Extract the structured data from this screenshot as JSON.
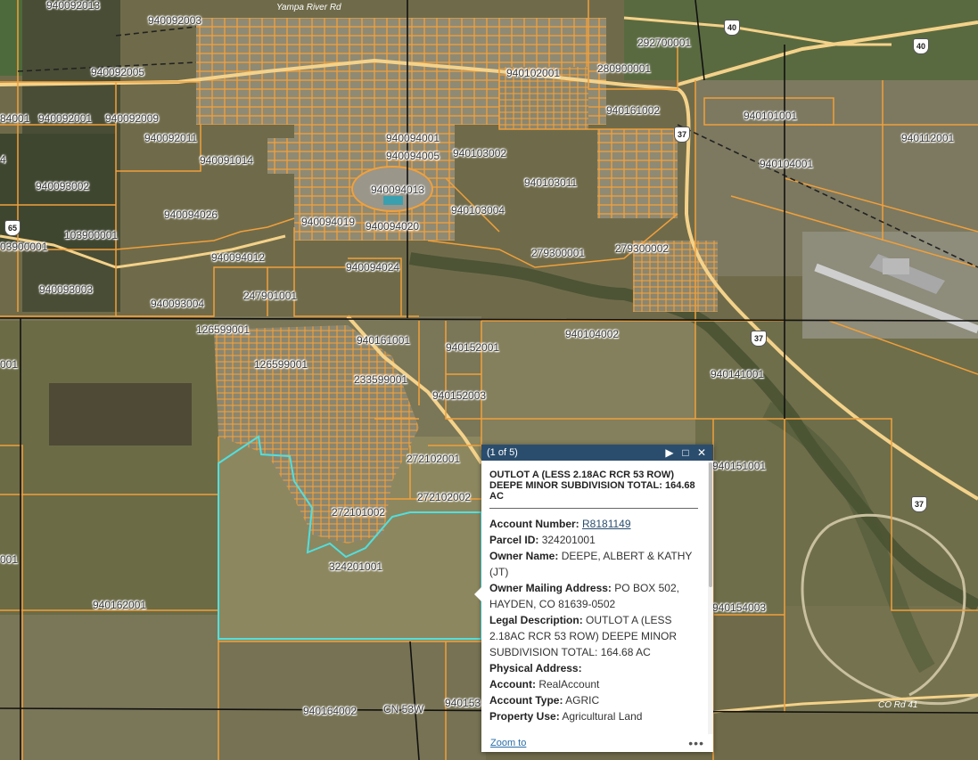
{
  "map": {
    "parcel_labels": [
      "940092013",
      "940092003",
      "940092005",
      "940092001",
      "940092009",
      "940092011",
      "940091014",
      "940093002",
      "940094026",
      "103900001",
      "940094012",
      "940093003",
      "940093004",
      "247901001",
      "940094019",
      "940094020",
      "940094024",
      "940094013",
      "940094001",
      "940094005",
      "940103002",
      "940103011",
      "940103004",
      "279300001",
      "279300002",
      "940102001",
      "292700001",
      "280900001",
      "940161002",
      "940101001",
      "940112001",
      "940104001",
      "126599001",
      "126599001",
      "940161001",
      "940152001",
      "233599001",
      "940152003",
      "940104002",
      "940141001",
      "272102001",
      "272102002",
      "272101002",
      "324201001",
      "940151001",
      "940162001",
      "940164002",
      "940153",
      "940154003",
      "84001",
      "4",
      "03900001",
      "001",
      "001"
    ],
    "highways": [
      "40",
      "40",
      "37",
      "37",
      "37",
      "65"
    ],
    "road_names": [
      "Yampa River Rd",
      "CN 53W",
      "CO Rd 41"
    ],
    "colors": {
      "parcel": "#f2a03a",
      "selected": "#4fe0e0",
      "grid": "#111111",
      "road": "#f4d28a",
      "header": "#2a4d6e"
    }
  },
  "popup": {
    "count": "(1 of 5)",
    "title": "OUTLOT A (LESS 2.18AC RCR 53 ROW) DEEPE MINOR SUBDIVISION TOTAL: 164.68 AC",
    "fields": [
      {
        "label": "Account Number:",
        "value": "R8181149",
        "link": true
      },
      {
        "label": "Parcel ID:",
        "value": "324201001"
      },
      {
        "label": "Owner Name:",
        "value": "DEEPE, ALBERT & KATHY (JT)"
      },
      {
        "label": "Owner Mailing Address:",
        "value": "PO BOX 502, HAYDEN, CO 81639-0502"
      },
      {
        "label": "Legal Description:",
        "value": "OUTLOT A (LESS 2.18AC RCR 53 ROW) DEEPE MINOR SUBDIVISION TOTAL: 164.68 AC"
      },
      {
        "label": "Physical Address:",
        "value": ""
      },
      {
        "label": "Account:",
        "value": "RealAccount"
      },
      {
        "label": "Account Type:",
        "value": "AGRIC"
      },
      {
        "label": "Property Use:",
        "value": "Agricultural Land"
      }
    ],
    "zoom_to": "Zoom to",
    "more": "•••"
  }
}
